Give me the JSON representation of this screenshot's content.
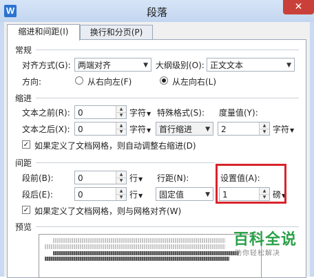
{
  "window": {
    "title": "段落",
    "app_icon": "W",
    "close_label": "✕"
  },
  "tabs": [
    {
      "label": "缩进和间距(I)",
      "active": true
    },
    {
      "label": "换行和分页(P)",
      "active": false
    }
  ],
  "general": {
    "heading": "常规",
    "alignment_label": "对齐方式(G):",
    "alignment_value": "两端对齐",
    "outline_label": "大纲级别(O):",
    "outline_value": "正文文本",
    "direction_label": "方向:",
    "rtl_label": "从右向左(F)",
    "ltr_label": "从左向右(L)",
    "direction_selected": "ltr"
  },
  "indent": {
    "heading": "缩进",
    "before_label": "文本之前(R):",
    "before_value": "0",
    "before_unit": "字符",
    "after_label": "文本之后(X):",
    "after_value": "0",
    "after_unit": "字符",
    "special_label": "特殊格式(S):",
    "special_value": "首行缩进",
    "measure_label": "度量值(Y):",
    "measure_value": "2",
    "measure_unit": "字符",
    "grid_check_label": "如果定义了文档网格，则自动调整右缩进(D)",
    "grid_check_checked": true
  },
  "spacing": {
    "heading": "间距",
    "before_label": "段前(B):",
    "before_value": "0",
    "before_unit": "行",
    "after_label": "段后(E):",
    "after_value": "0",
    "after_unit": "行",
    "line_label": "行距(N):",
    "line_value": "固定值",
    "setting_label": "设置值(A):",
    "setting_value": "1",
    "setting_unit": "磅",
    "grid_check_label": "如果定义了文档网格，则与网格对齐(W)",
    "grid_check_checked": true
  },
  "preview": {
    "heading": "预览"
  },
  "watermark": {
    "title": "百科全说",
    "subtitle": "助你轻松解决"
  },
  "colors": {
    "highlight": "#d9232b",
    "titlebar": "#c9daf2",
    "close": "#c9403a",
    "watermark": "#2aa14a"
  }
}
